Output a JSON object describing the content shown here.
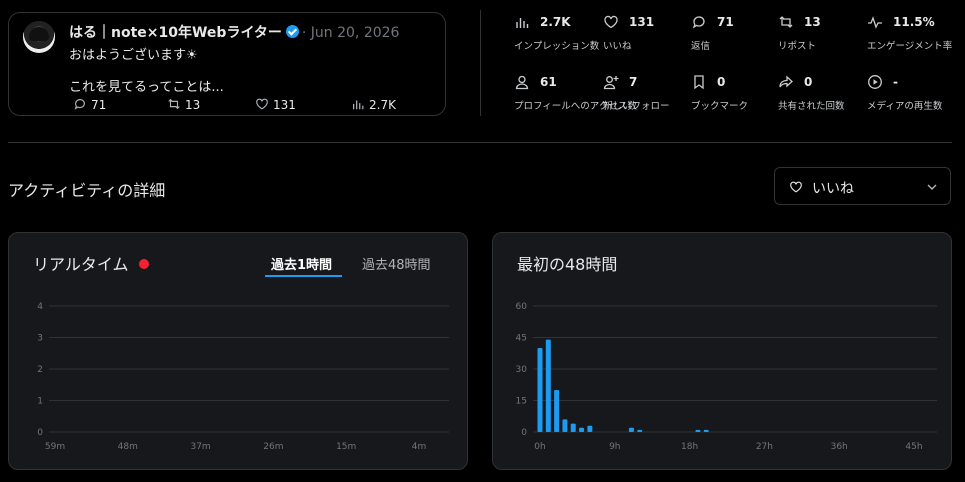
{
  "tweet": {
    "author": "はる｜note×10年Webライター",
    "date": "· Jun 20, 2026",
    "line1": "おはようございます☀",
    "line2": "これを見てるってことは...",
    "replies": "71",
    "reposts": "13",
    "likes": "131",
    "views": "2.7K"
  },
  "metrics": [
    {
      "value": "2.7K",
      "label": "インプレッション数",
      "icon": "bar-chart-icon"
    },
    {
      "value": "131",
      "label": "いいね",
      "icon": "heart-icon"
    },
    {
      "value": "71",
      "label": "返信",
      "icon": "reply-icon"
    },
    {
      "value": "13",
      "label": "リポスト",
      "icon": "repost-icon"
    },
    {
      "value": "11.5%",
      "label": "エンゲージメント率",
      "icon": "pulse-icon"
    },
    {
      "value": "61",
      "label": "プロフィールへのアクセス数",
      "icon": "profile-icon"
    },
    {
      "value": "7",
      "label": "新しいフォロー",
      "icon": "add-user-icon"
    },
    {
      "value": "0",
      "label": "ブックマーク",
      "icon": "bookmark-icon"
    },
    {
      "value": "0",
      "label": "共有された回数",
      "icon": "share-icon"
    },
    {
      "value": "-",
      "label": "メディアの再生数",
      "icon": "play-icon"
    }
  ],
  "activity": {
    "title": "アクティビティの詳細",
    "dropdown_value": "いいね"
  },
  "realtime": {
    "title": "リアルタイム",
    "tab_active": "過去1時間",
    "tab_inactive": "過去48時間"
  },
  "first48": {
    "title": "最初の48時間"
  },
  "colors": {
    "accent": "#1d9bf0",
    "live": "#f4212e",
    "panel": "#16181c",
    "border": "#2f3336"
  },
  "chart_data": [
    {
      "type": "bar",
      "title": "リアルタイム",
      "x_tick_labels": [
        "59m",
        "48m",
        "37m",
        "26m",
        "15m",
        "4m"
      ],
      "y_tick_labels": [
        "0",
        "1",
        "2",
        "3",
        "4"
      ],
      "ylim": [
        0,
        4
      ],
      "values": [],
      "grid": true
    },
    {
      "type": "bar",
      "title": "最初の48時間",
      "x_tick_labels": [
        "0h",
        "9h",
        "18h",
        "27h",
        "36h",
        "45h"
      ],
      "y_tick_labels": [
        "0",
        "15",
        "30",
        "45",
        "60"
      ],
      "ylim": [
        0,
        60
      ],
      "x_unit_hours": 48,
      "bars": [
        {
          "h": 0,
          "v": 40
        },
        {
          "h": 1,
          "v": 44
        },
        {
          "h": 2,
          "v": 20
        },
        {
          "h": 3,
          "v": 6
        },
        {
          "h": 4,
          "v": 4
        },
        {
          "h": 5,
          "v": 2
        },
        {
          "h": 6,
          "v": 3
        },
        {
          "h": 11,
          "v": 2
        },
        {
          "h": 12,
          "v": 1
        },
        {
          "h": 19,
          "v": 1
        },
        {
          "h": 20,
          "v": 1
        }
      ],
      "grid": true
    }
  ]
}
